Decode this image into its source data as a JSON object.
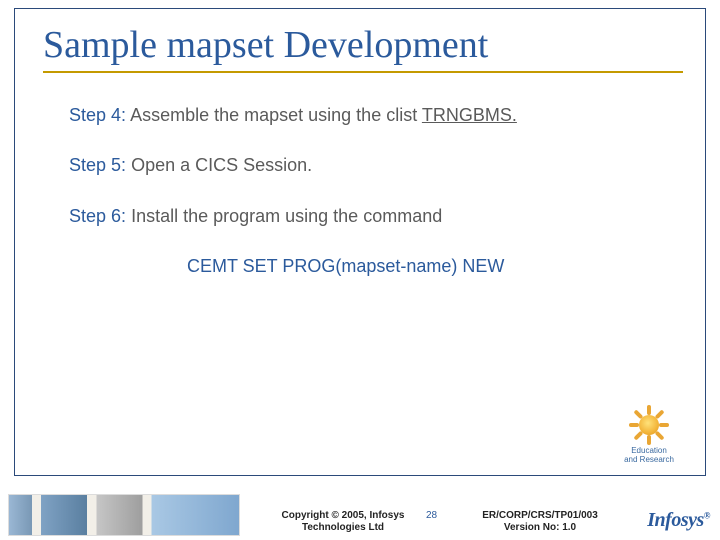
{
  "title": "Sample mapset Development",
  "steps": {
    "s4": {
      "label": "Step 4:",
      "text_a": "Assemble the mapset using the clist ",
      "text_u": "TRNGBMS.",
      "text_b": ""
    },
    "s5": {
      "label": "Step 5:",
      "text": "Open a CICS Session."
    },
    "s6": {
      "label": "Step 6:",
      "text": "Install the program using the command"
    }
  },
  "command": "CEMT SET PROG(mapset-name) NEW",
  "edu_logo": {
    "line1": "Education",
    "line2": "and Research"
  },
  "footer": {
    "copyright_l1": "Copyright © 2005, Infosys",
    "copyright_l2": "Technologies Ltd",
    "page": "28",
    "ref_l1": "ER/CORP/CRS/TP01/003",
    "ref_l2": "Version No: 1.0",
    "brand": "Infosys",
    "reg": "®"
  }
}
